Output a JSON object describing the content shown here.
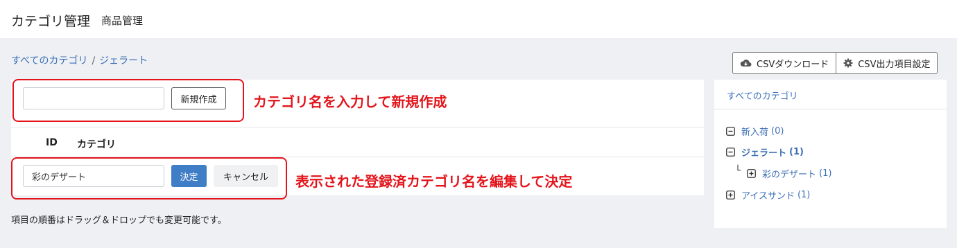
{
  "header": {
    "title": "カテゴリ管理",
    "subtitle": "商品管理"
  },
  "breadcrumb": {
    "root": "すべてのカテゴリ",
    "separator": "/",
    "current": "ジェラート"
  },
  "toolbar": {
    "csv_download": "CSVダウンロード",
    "csv_settings": "CSV出力項目設定"
  },
  "new_category": {
    "input_value": "",
    "button": "新規作成"
  },
  "table": {
    "columns": [
      "ID",
      "カテゴリ"
    ],
    "edit_row": {
      "input_value": "彩のデザート",
      "confirm": "決定",
      "cancel": "キャンセル"
    }
  },
  "annotations": {
    "new": "カテゴリ名を入力して新規作成",
    "edit": "表示された登録済カテゴリ名を編集して決定"
  },
  "note": "項目の順番はドラッグ＆ドロップでも変更可能です。",
  "sidebar": {
    "title": "すべてのカテゴリ",
    "tree": [
      {
        "label": "新入荷",
        "count": "(0)",
        "icon": "minus-square-icon"
      },
      {
        "label": "ジェラート",
        "count": "(1)",
        "icon": "minus-square-icon"
      },
      {
        "label": "彩のデザート",
        "count": "(1)",
        "icon": "plus-square-icon"
      },
      {
        "label": "アイスサンド",
        "count": "(1)",
        "icon": "plus-square-icon"
      }
    ],
    "elbow": "└"
  },
  "colors": {
    "annotation": "#e3141b",
    "link": "#3b6fb6",
    "primary": "#3f7dc6",
    "page_bg": "#eef0f4"
  }
}
